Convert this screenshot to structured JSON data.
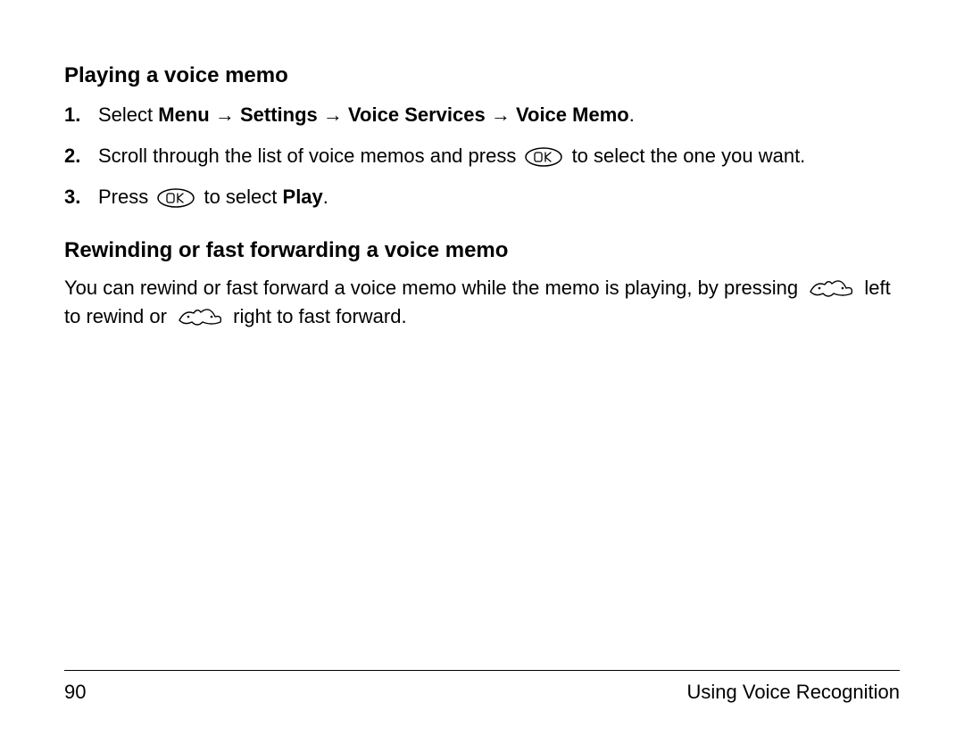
{
  "sections": {
    "playing": {
      "heading": "Playing a voice memo",
      "step1_pre": "Select ",
      "step1_nav_menu": "Menu",
      "step1_nav_settings": "Settings",
      "step1_nav_voiceservices": "Voice Services",
      "step1_nav_voicememo": "Voice Memo",
      "step1_period": ".",
      "step2_pre": "Scroll through the list of voice memos and press ",
      "step2_post": " to select the one you want.",
      "step3_pre": "Press ",
      "step3_mid": " to select ",
      "step3_play": "Play",
      "step3_period": "."
    },
    "rewind": {
      "heading": "Rewinding or fast forwarding a voice memo",
      "para_pre": "You can rewind or fast forward a voice memo while the memo is playing, by pressing ",
      "para_mid": " left to rewind or ",
      "para_post": " right to fast forward."
    }
  },
  "glyphs": {
    "arrow": "→"
  },
  "footer": {
    "page": "90",
    "chapter": "Using Voice Recognition"
  }
}
